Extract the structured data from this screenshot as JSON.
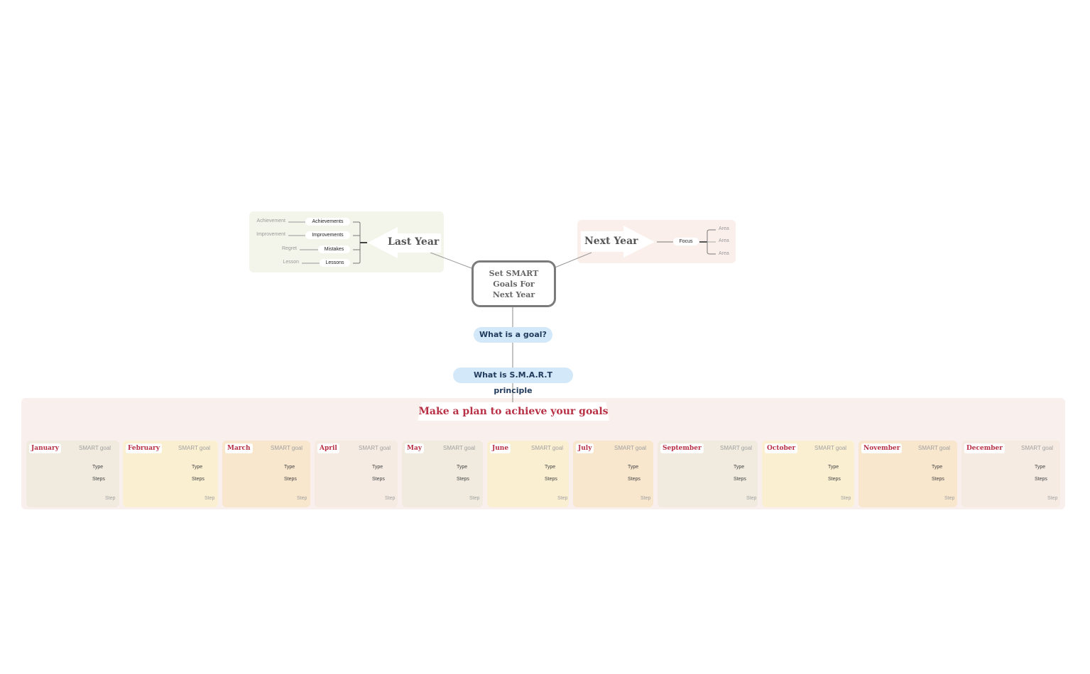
{
  "central_topic": {
    "line1": "Set SMART",
    "line2": "Goals For",
    "line3": "Next Year"
  },
  "last_year": {
    "title": "Last Year",
    "rows": [
      {
        "label": "Achievements",
        "detail": "Achievement"
      },
      {
        "label": "Improvements",
        "detail": "Improvement"
      },
      {
        "label": "Mistakes",
        "detail": "Regret"
      },
      {
        "label": "Lessons",
        "detail": "Lesson"
      }
    ]
  },
  "next_year": {
    "title": "Next Year",
    "focus": "Focus",
    "areas": [
      "Area",
      "Area",
      "Area"
    ]
  },
  "questions": {
    "goal": "What is a goal?",
    "smart": "What is S.M.A.R.T principle"
  },
  "plan": {
    "title": "Make a plan to achieve your goals",
    "smart_goal_label": "SMART goal",
    "type_label": "Type",
    "steps_label": "Steps",
    "step_label": "Step",
    "months": [
      {
        "name": "January",
        "color": "#f0ebde"
      },
      {
        "name": "February",
        "color": "#fbefd2"
      },
      {
        "name": "March",
        "color": "#f8e6cd"
      },
      {
        "name": "April",
        "color": "#f6ebe2"
      },
      {
        "name": "May",
        "color": "#f0ebde"
      },
      {
        "name": "June",
        "color": "#fbefd2"
      },
      {
        "name": "July",
        "color": "#f8e6cd"
      },
      {
        "name": "September",
        "color": "#f0ebde"
      },
      {
        "name": "October",
        "color": "#fbefd2"
      },
      {
        "name": "November",
        "color": "#f8e6cd"
      },
      {
        "name": "December",
        "color": "#f6ebe2"
      }
    ]
  }
}
